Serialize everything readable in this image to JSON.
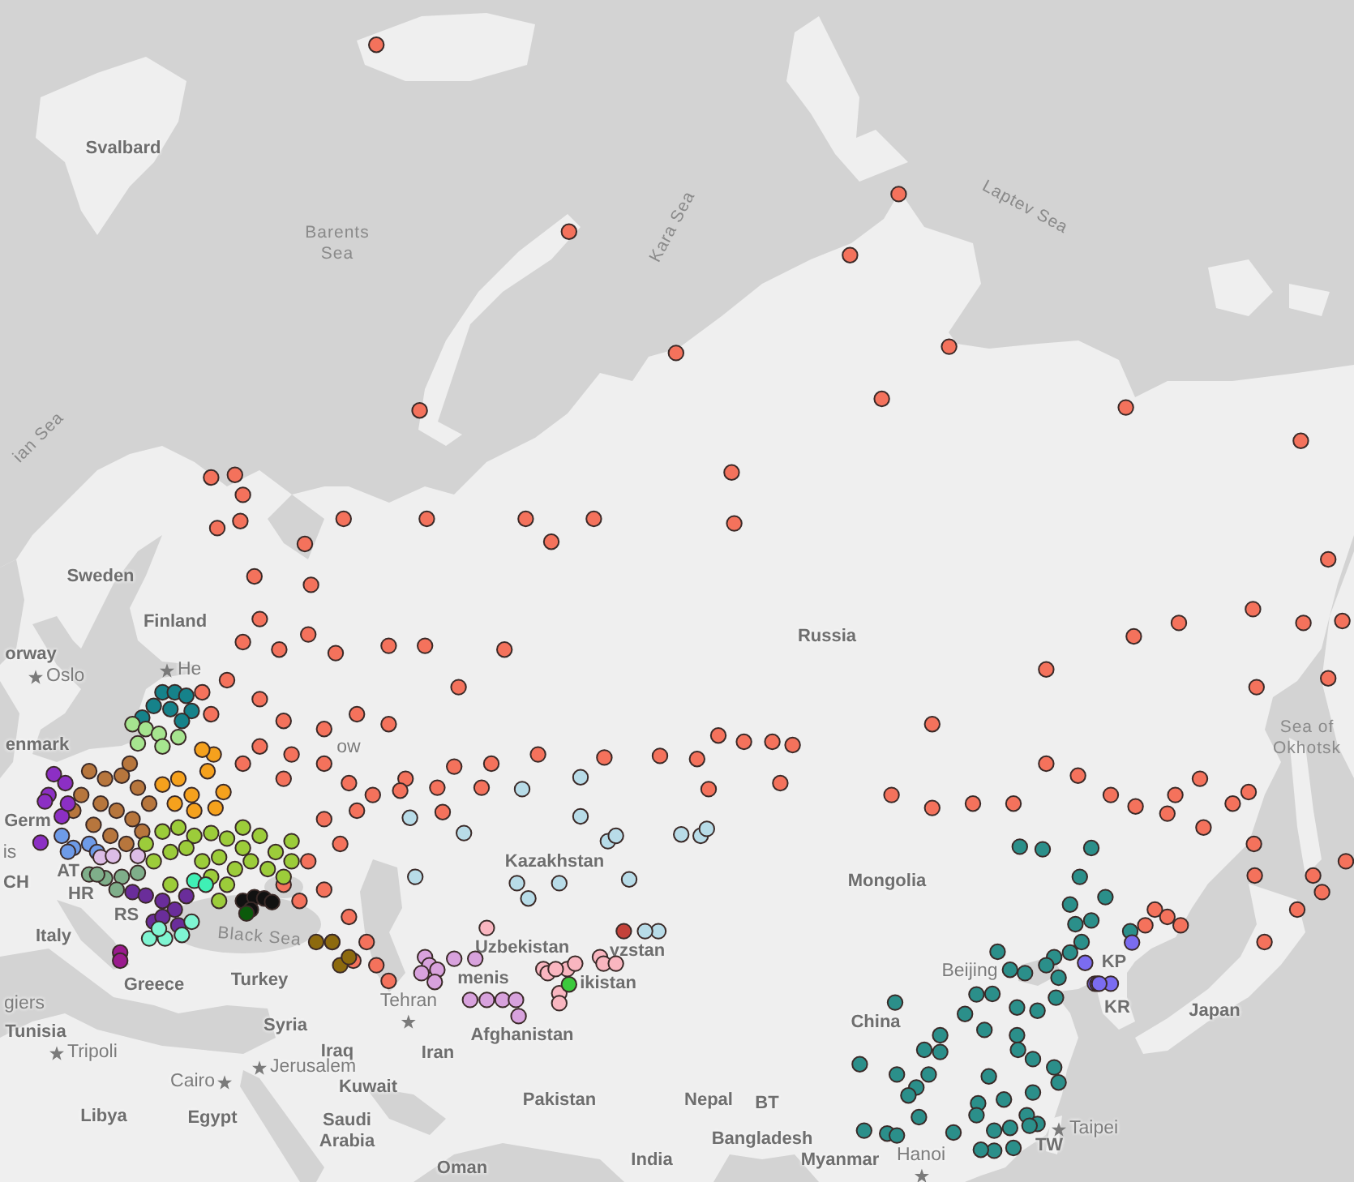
{
  "map": {
    "labels": [
      {
        "text": "Svalbard",
        "kind": "country"
      },
      {
        "text": "Laptev Sea",
        "kind": "sea"
      },
      {
        "text": "Kara Sea",
        "kind": "sea"
      },
      {
        "text": "Barents\nSea",
        "kind": "sea"
      },
      {
        "text": "ian Sea",
        "kind": "sea"
      },
      {
        "text": "Sweden",
        "kind": "country"
      },
      {
        "text": "Finland",
        "kind": "country"
      },
      {
        "text": "Russia",
        "kind": "country"
      },
      {
        "text": "orway",
        "kind": "country"
      },
      {
        "text": "He",
        "kind": "capital"
      },
      {
        "text": "Oslo",
        "kind": "capital"
      },
      {
        "text": "enmark",
        "kind": "country"
      },
      {
        "text": "ow",
        "kind": "place"
      },
      {
        "text": "Sea of\nOkhotsk",
        "kind": "sea"
      },
      {
        "text": "Germ",
        "kind": "country"
      },
      {
        "text": "is",
        "kind": "place"
      },
      {
        "text": "Kazakhstan",
        "kind": "country"
      },
      {
        "text": "AT",
        "kind": "country"
      },
      {
        "text": "Mongolia",
        "kind": "country"
      },
      {
        "text": "CH",
        "kind": "country"
      },
      {
        "text": "HR",
        "kind": "country"
      },
      {
        "text": "RS",
        "kind": "country"
      },
      {
        "text": "Black Sea",
        "kind": "sea"
      },
      {
        "text": "Italy",
        "kind": "country"
      },
      {
        "text": "Uzbekistan",
        "kind": "country"
      },
      {
        "text": "yzstan",
        "kind": "country"
      },
      {
        "text": "KP",
        "kind": "country"
      },
      {
        "text": "Greece",
        "kind": "country"
      },
      {
        "text": "Turkey",
        "kind": "country"
      },
      {
        "text": "menis",
        "kind": "country"
      },
      {
        "text": "ikistan",
        "kind": "country"
      },
      {
        "text": "Beijing",
        "kind": "place"
      },
      {
        "text": "giers",
        "kind": "place"
      },
      {
        "text": "Tehran",
        "kind": "capital"
      },
      {
        "text": "KR",
        "kind": "country"
      },
      {
        "text": "Japan",
        "kind": "country"
      },
      {
        "text": "Tunisia",
        "kind": "country"
      },
      {
        "text": "Syria",
        "kind": "country"
      },
      {
        "text": "Afghanistan",
        "kind": "country"
      },
      {
        "text": "China",
        "kind": "country"
      },
      {
        "text": "Tripoli",
        "kind": "capital"
      },
      {
        "text": "Iraq",
        "kind": "country"
      },
      {
        "text": "Iran",
        "kind": "country"
      },
      {
        "text": "Jerusalem",
        "kind": "capital"
      },
      {
        "text": "Cairo",
        "kind": "capital"
      },
      {
        "text": "Kuwait",
        "kind": "country"
      },
      {
        "text": "Pakistan",
        "kind": "country"
      },
      {
        "text": "Nepal",
        "kind": "country"
      },
      {
        "text": "BT",
        "kind": "country"
      },
      {
        "text": "Libya",
        "kind": "country"
      },
      {
        "text": "Egypt",
        "kind": "country"
      },
      {
        "text": "Saudi\nArabia",
        "kind": "country"
      },
      {
        "text": "Bangladesh",
        "kind": "country"
      },
      {
        "text": "Taipei",
        "kind": "capital"
      },
      {
        "text": "TW",
        "kind": "country"
      },
      {
        "text": "Oman",
        "kind": "country"
      },
      {
        "text": "India",
        "kind": "country"
      },
      {
        "text": "Myanmar",
        "kind": "country"
      },
      {
        "text": "Hanoi",
        "kind": "capital"
      }
    ],
    "series": [
      {
        "color": "#f4725c"
      },
      {
        "color": "#2b8f8a"
      },
      {
        "color": "#16828a"
      },
      {
        "color": "#a6e58f"
      },
      {
        "color": "#f5a11d"
      },
      {
        "color": "#b7763d"
      },
      {
        "color": "#8c2fc4"
      },
      {
        "color": "#6e9be8"
      },
      {
        "color": "#dcbde6"
      },
      {
        "color": "#7fae8a"
      },
      {
        "color": "#9ccc3a"
      },
      {
        "color": "#3ff0b5"
      },
      {
        "color": "#6a2d9a"
      },
      {
        "color": "#7ff5d2"
      },
      {
        "color": "#111111"
      },
      {
        "color": "#0b5a0b"
      },
      {
        "color": "#8d6a0e"
      },
      {
        "color": "#9a1a8e"
      },
      {
        "color": "#d8a2dd"
      },
      {
        "color": "#f9b6c0"
      },
      {
        "color": "#3cc83c"
      },
      {
        "color": "#c4423a"
      },
      {
        "color": "#b8dce8"
      },
      {
        "color": "#7b6cf0"
      }
    ]
  }
}
